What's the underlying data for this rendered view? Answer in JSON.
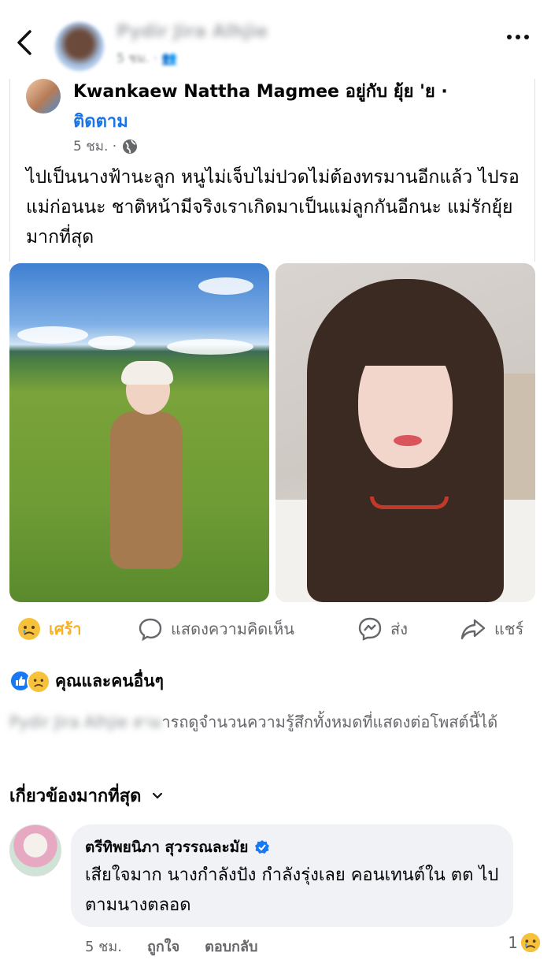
{
  "header": {
    "author_blurred": "Pydir Jira Alhjie",
    "meta_blurred": "5 ชม. · 👥"
  },
  "shared_post": {
    "author": "Kwankaew Nattha Magmee",
    "with_text": "อยู่กับ ยุ้ย 'ย ·",
    "follow": "ติดตาม",
    "time": "5 ชม. ·",
    "text": "ไปเป็นนางฟ้านะลูก หนูไม่เจ็บไม่ปวดไม่ต้องทรมานอีกแล้ว ไปรอแม่ก่อนนะ ชาติหน้ามีจริงเราเกิดมาเป็นแม่ลูกกันอีกนะ แม่รักยุ้ยมากที่สุด"
  },
  "actions": {
    "reaction": "เศร้า",
    "comment": "แสดงความคิดเห็น",
    "send": "ส่ง",
    "share": "แชร์"
  },
  "reactions_summary": {
    "text": "คุณและคนอื่นๆ"
  },
  "privacy": {
    "name_blurred": "Pydir Jira Alhjie สาม",
    "text": "ารถดูจำนวนความรู้สึกทั้งหมดที่แสดงต่อโพสต์นี้ได้"
  },
  "comments_filter": {
    "label": "เกี่ยวข้องมากที่สุด"
  },
  "comment": {
    "name": "ตรีทิพยนิภา สุวรรณละมัย",
    "text": "เสียใจมาก นางกำลังปัง กำลังรุ่งเลย คอนเทนต์ใน ตต ไปตามนางตลอด",
    "time": "5 ชม.",
    "like": "ถูกใจ",
    "reply": "ตอบกลับ",
    "reaction_count": "1"
  },
  "colors": {
    "link_blue": "#1b74e4",
    "sad_yellow": "#f7b125",
    "secondary_text": "#65676b",
    "bubble": "#f0f2f5"
  }
}
